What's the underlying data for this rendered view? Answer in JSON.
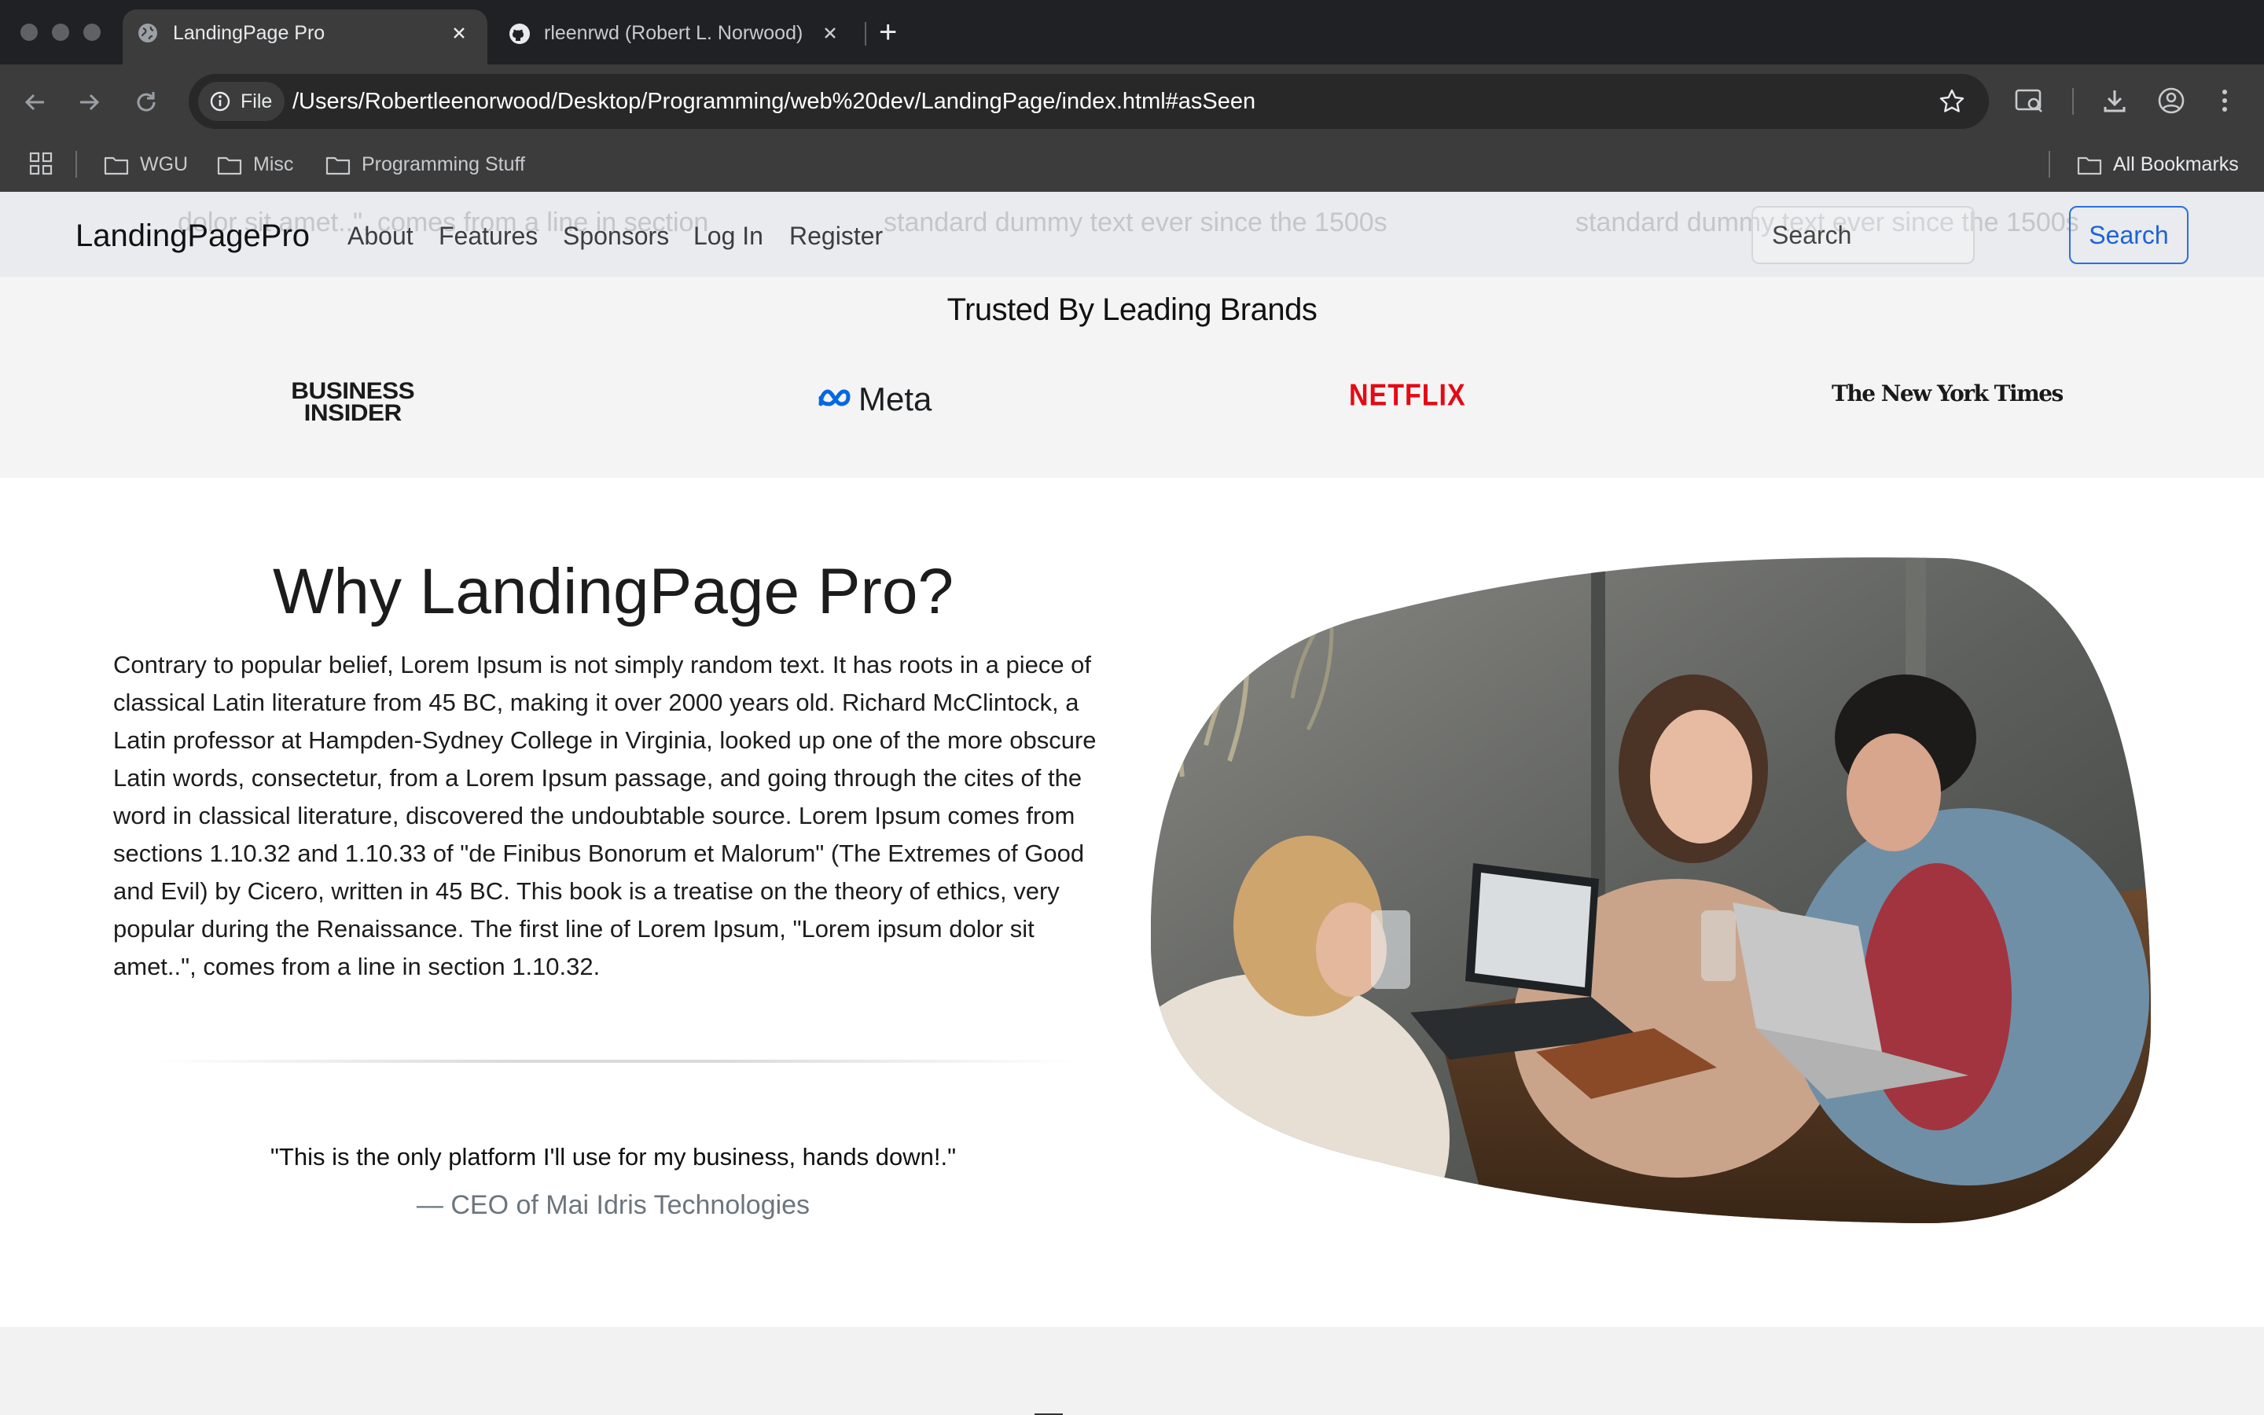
{
  "browser": {
    "tabs": [
      {
        "title": "LandingPage Pro",
        "icon": "globe-icon",
        "active": true
      },
      {
        "title": "rleenrwd (Robert L. Norwood)",
        "icon": "github-icon",
        "active": false
      }
    ],
    "new_tab_label": "+",
    "address": {
      "chip": "File",
      "url": "/Users/Robertleenorwood/Desktop/Programming/web%20dev/LandingPage/index.html#asSeen"
    },
    "bookmarks": [
      "WGU",
      "Misc",
      "Programming Stuff"
    ],
    "all_bookmarks": "All Bookmarks"
  },
  "navbar": {
    "brand": "LandingPagePro",
    "links": [
      "About",
      "Features",
      "Sponsors",
      "Log In",
      "Register"
    ],
    "search_placeholder": "Search",
    "search_button": "Search",
    "ghost_text": [
      "dolor sit amet..\", comes from a line in section",
      "standard dummy text ever since the 1500s",
      "standard dummy text ever since the 1500s"
    ]
  },
  "brands": {
    "title": "Trusted By Leading Brands",
    "logos": {
      "business_insider_line1": "BUSINESS",
      "business_insider_line2": "INSIDER",
      "meta": "Meta",
      "netflix": "NETFLIX",
      "nyt": "The New York Times"
    }
  },
  "why": {
    "title": "Why LandingPage Pro?",
    "body": "Contrary to popular belief, Lorem Ipsum is not simply random text. It has roots in a piece of classical Latin literature from 45 BC, making it over 2000 years old. Richard McClintock, a Latin professor at Hampden-Sydney College in Virginia, looked up one of the more obscure Latin words, consectetur, from a Lorem Ipsum passage, and going through the cites of the word in classical literature, discovered the undoubtable source. Lorem Ipsum comes from sections 1.10.32 and 1.10.33 of \"de Finibus Bonorum et Malorum\" (The Extremes of Good and Evil) by Cicero, written in 45 BC. This book is a treatise on the theory of ethics, very popular during the Renaissance. The first line of Lorem Ipsum, \"Lorem ipsum dolor sit amet..\", comes from a line in section 1.10.32.",
    "quote": "\"This is the only platform I'll use for my business, hands down!.\"",
    "author": "— CEO of Mai Idris Technologies"
  },
  "colors": {
    "accent": "#1e63d4",
    "netflix": "#e50914",
    "chrome_dark": "#202124",
    "chrome_toolbar": "#3c3c3c"
  }
}
